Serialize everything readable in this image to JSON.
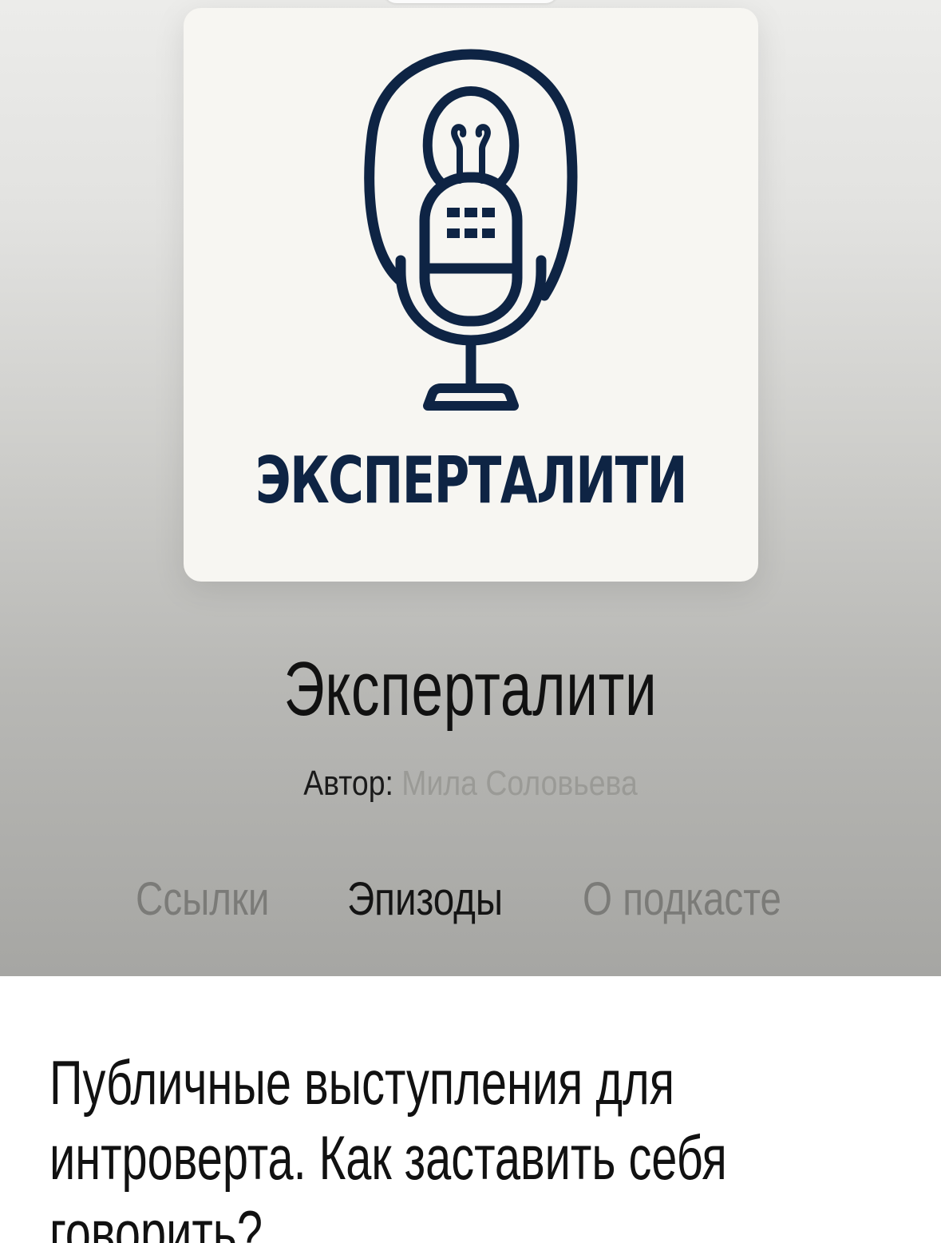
{
  "cover": {
    "wordmark": "ЭКСПЕРТАЛИТИ",
    "logo_icon": "microphone-lightbulb-icon",
    "logo_color": "#0e2444"
  },
  "podcast": {
    "title": "Эксперталити",
    "author_label": "Автор:",
    "author_name": "Мила Соловьева"
  },
  "tabs": [
    {
      "label": "Ссылки",
      "active": false
    },
    {
      "label": "Эпизоды",
      "active": true
    },
    {
      "label": "О подкасте",
      "active": false
    }
  ],
  "episode": {
    "title_lines": [
      "Публичные выступления для",
      "интроверта. Как заставить себя",
      "говорить?"
    ]
  }
}
